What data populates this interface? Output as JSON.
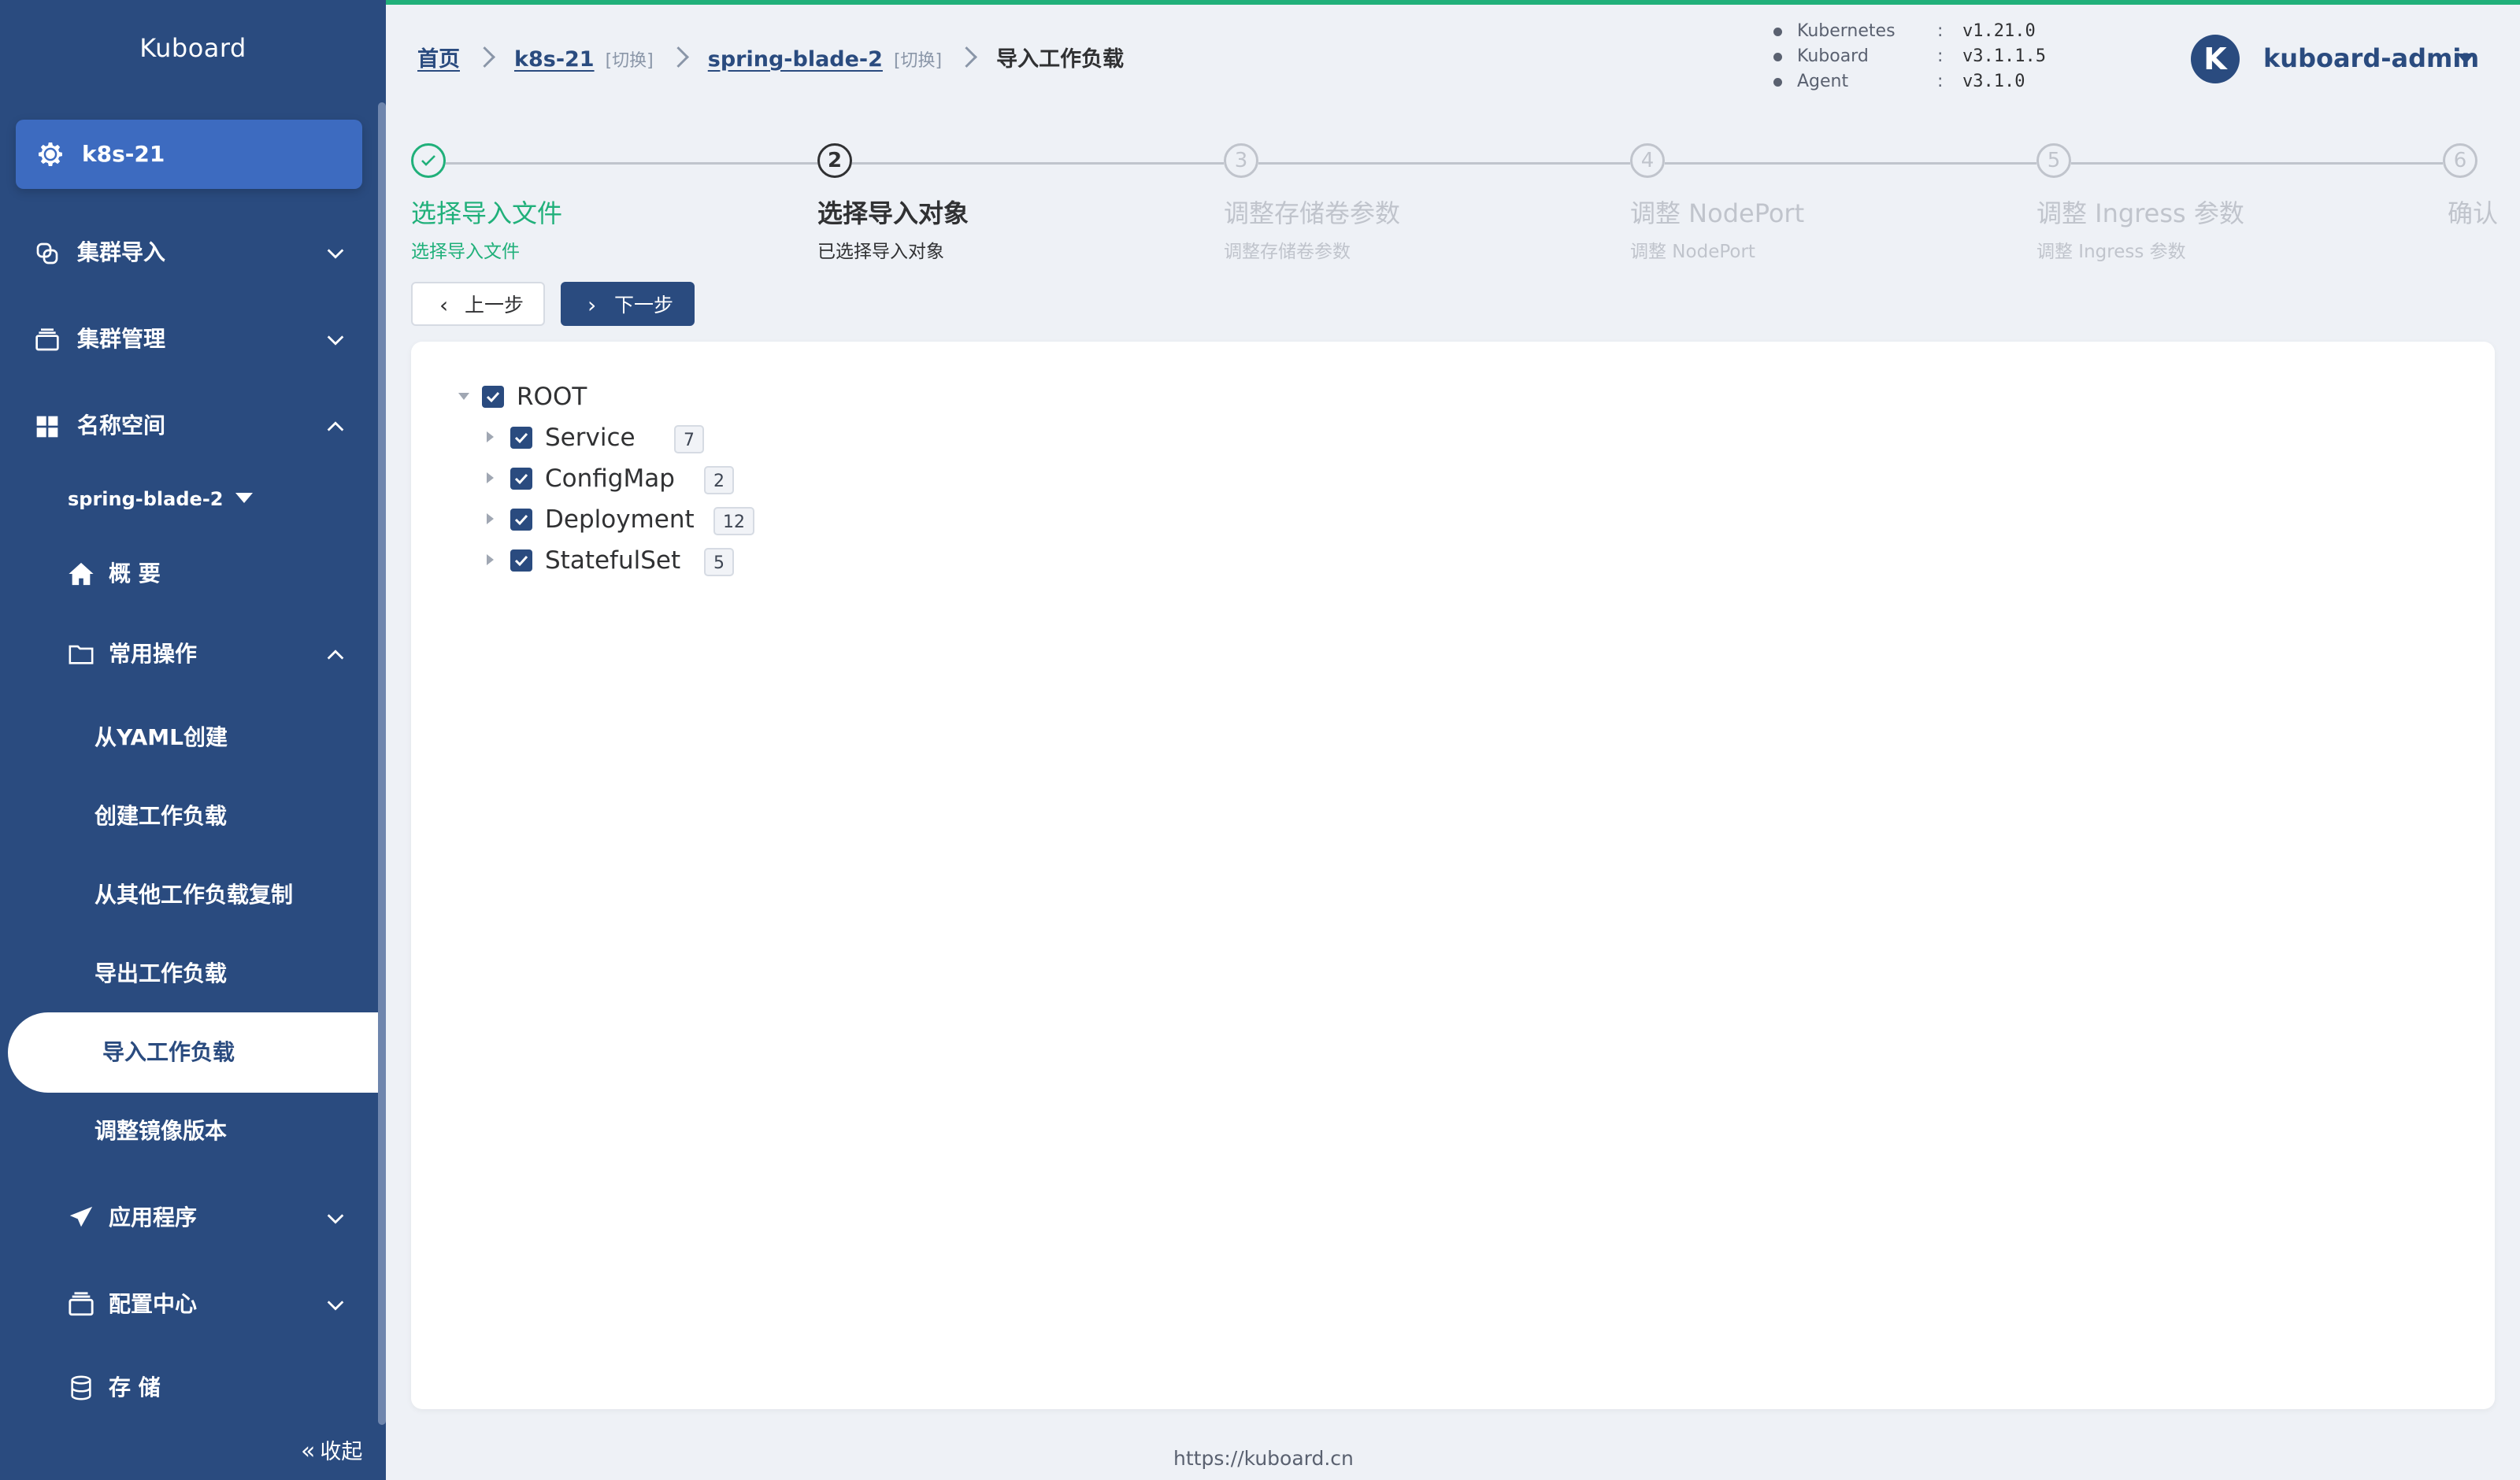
{
  "sidebar": {
    "logo": "Kuboard",
    "cluster": "k8s-21",
    "groups": {
      "cluster_import": "集群导入",
      "cluster_manage": "集群管理",
      "namespace": "名称空间"
    },
    "namespace_selector": "spring-blade-2",
    "overview": "概 要",
    "common_ops": "常用操作",
    "ops_items": [
      "从YAML创建",
      "创建工作负载",
      "从其他工作负载复制",
      "导出工作负载",
      "导入工作负载",
      "调整镜像版本"
    ],
    "apps": "应用程序",
    "config_center": "配置中心",
    "storage": "存 储",
    "collapse": "收起"
  },
  "breadcrumb": {
    "home": "首页",
    "cluster": "k8s-21",
    "cluster_switch": "[切换]",
    "namespace": "spring-blade-2",
    "namespace_switch": "[切换]",
    "current": "导入工作负载"
  },
  "versions": [
    {
      "name": "Kubernetes",
      "sep": ":",
      "value": "v1.21.0"
    },
    {
      "name": "Kuboard",
      "sep": ":",
      "value": "v3.1.1.5"
    },
    {
      "name": "Agent",
      "sep": ":",
      "value": "v3.1.0"
    }
  ],
  "user": {
    "avatar_letter": "K",
    "name": "kuboard-admin"
  },
  "steps": [
    {
      "number": "1",
      "title": "选择导入文件",
      "desc": "选择导入文件",
      "status": "done"
    },
    {
      "number": "2",
      "title": "选择导入对象",
      "desc": "已选择导入对象",
      "status": "active"
    },
    {
      "number": "3",
      "title": "调整存储卷参数",
      "desc": "调整存储卷参数",
      "status": "wait"
    },
    {
      "number": "4",
      "title": "调整 NodePort",
      "desc": "调整 NodePort",
      "status": "wait"
    },
    {
      "number": "5",
      "title": "调整 Ingress 参数",
      "desc": "调整 Ingress 参数",
      "status": "wait"
    },
    {
      "number": "6",
      "title": "确认",
      "desc": "",
      "status": "wait"
    }
  ],
  "buttons": {
    "prev": "上一步",
    "next": "下一步"
  },
  "tree": {
    "root": "ROOT",
    "children": [
      {
        "label": "Service",
        "count": "7"
      },
      {
        "label": "ConfigMap",
        "count": "2"
      },
      {
        "label": "Deployment",
        "count": "12"
      },
      {
        "label": "StatefulSet",
        "count": "5"
      }
    ]
  },
  "footer": "https://kuboard.cn",
  "colors": {
    "accent": "#2a4b7f",
    "success": "#20b07a",
    "sidebar_bg": "#2a4b7f",
    "muted": "#c0c4cc"
  }
}
